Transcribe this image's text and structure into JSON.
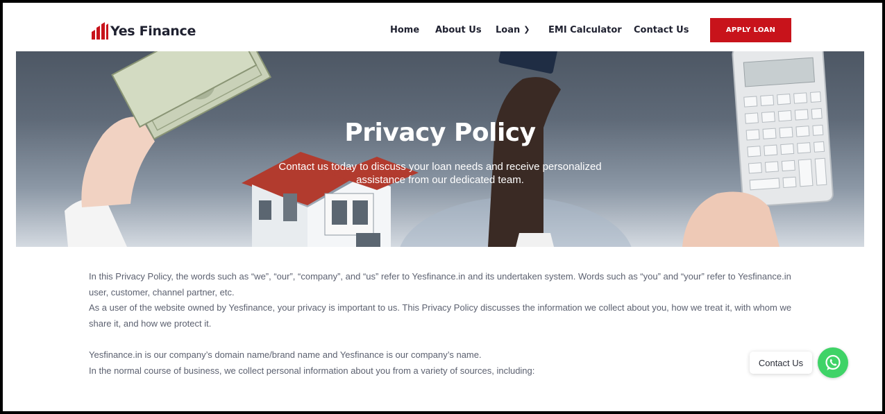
{
  "brand": {
    "name": "Yes Finance",
    "accent_color": "#c8131b"
  },
  "nav": {
    "home": "Home",
    "about": "About Us",
    "loan": "Loan",
    "emi": "EMI Calculator",
    "contact": "Contact Us",
    "loan_dropdown_icon": "chevron-down-icon"
  },
  "header": {
    "apply_button": "APPLY LOAN"
  },
  "hero": {
    "title": "Privacy Policy",
    "subtitle": "Contact us today to discuss your loan needs and receive personalized assistance from our dedicated team."
  },
  "content": {
    "paragraphs": [
      "In this Privacy Policy, the words such as “we”, “our”, “company”, and “us” refer to Yesfinance.in and its undertaken system. Words such as “you” and “your” refer to Yesfinance.in user, customer, channel partner, etc.",
      "As a user of the website owned by Yesfinance, your privacy is important to us. This Privacy Policy discusses the information we collect about you, how we treat it, with whom we share it, and how we protect it.",
      "Yesfinance.in is our company’s domain name/brand name and Yesfinance is our company’s name.",
      "In the normal course of business, we collect personal information about you from a variety of sources, including:"
    ]
  },
  "floating": {
    "contact_label": "Contact Us",
    "whatsapp_icon": "whatsapp-icon",
    "whatsapp_color": "#3fd367"
  }
}
